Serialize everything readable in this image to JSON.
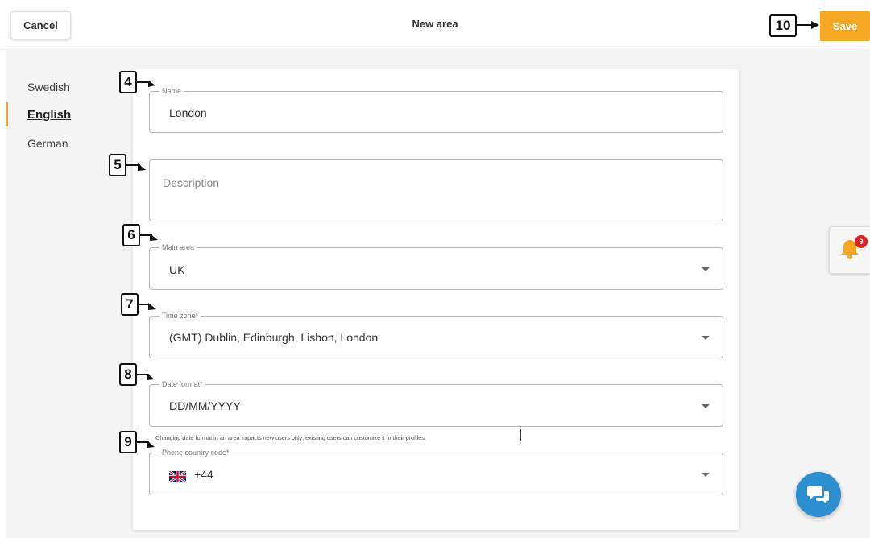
{
  "header": {
    "cancel_label": "Cancel",
    "title": "New area",
    "save_label": "Save"
  },
  "languages": {
    "items": [
      {
        "label": "Swedish",
        "active": false
      },
      {
        "label": "English",
        "active": true
      },
      {
        "label": "German",
        "active": false
      }
    ]
  },
  "form": {
    "name": {
      "legend": "Name",
      "value": "London"
    },
    "description": {
      "placeholder": "Description"
    },
    "main_area": {
      "legend": "Main area",
      "value": "UK"
    },
    "time_zone": {
      "legend": "Time zone*",
      "value": "(GMT) Dublin, Edinburgh, Lisbon, London"
    },
    "date_format": {
      "legend": "Date format*",
      "value": "DD/MM/YYYY",
      "helper": "Changing date format in an area impacts new users only; existing users can customize it in their profiles."
    },
    "phone_code": {
      "legend": "Phone country code*",
      "value": "+44",
      "flag_icon": "uk-flag-icon"
    }
  },
  "notifications": {
    "count": "9",
    "icon": "bell-icon"
  },
  "chat": {
    "icon": "chat-bubbles-icon"
  },
  "callouts": [
    "4",
    "5",
    "6",
    "7",
    "8",
    "9",
    "10"
  ],
  "colors": {
    "accent": "#f5a623",
    "badge": "#e02020",
    "chat": "#2d8fd0"
  }
}
